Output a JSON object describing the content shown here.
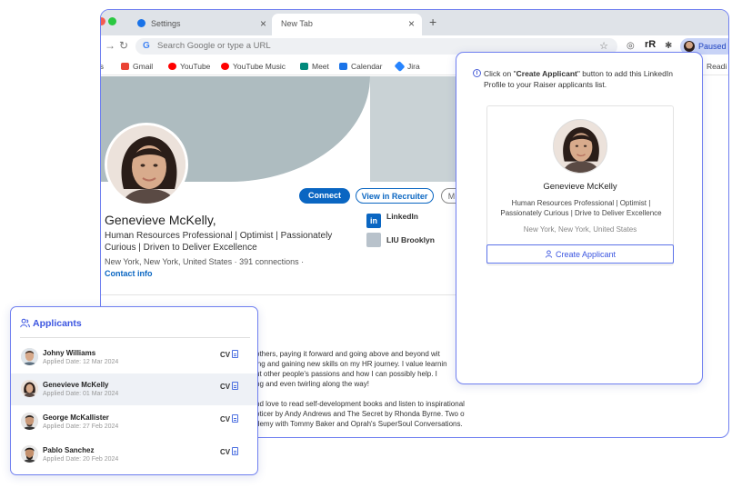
{
  "browser": {
    "tabs": [
      {
        "label": "Settings"
      },
      {
        "label": "New Tab"
      }
    ],
    "omnibox_placeholder": "Search Google or type a URL",
    "profile_status": "Paused",
    "extension_label": "rR",
    "bookmarks": [
      {
        "label": "ps",
        "color": "#ffffff"
      },
      {
        "label": "Gmail",
        "color": "#ea4335"
      },
      {
        "label": "YouTube",
        "color": "#ff0000"
      },
      {
        "label": "YouTube Music",
        "color": "#ff0000"
      },
      {
        "label": "Meet",
        "color": "#00897b"
      },
      {
        "label": "Calendar",
        "color": "#1a73e8"
      },
      {
        "label": "Jira",
        "color": "#2684ff"
      },
      {
        "label": "Readi",
        "color": "#ffffff"
      }
    ]
  },
  "linkedin": {
    "name": "Genevieve McKelly,",
    "headline": "Human Resources Professional | Optimist | Passionately Curious | Driven to Deliver Excellence",
    "location": "New York, New York, United States",
    "connections": "391 connections",
    "contact_info": "Contact info",
    "connect_label": "Connect",
    "recruiter_label": "View in Recruiter",
    "more_label": "M",
    "orgs": [
      {
        "label": "LinkedIn",
        "color": "#0a66c2"
      },
      {
        "label": "LIU Brooklyn",
        "color": "#8c9aa8"
      }
    ],
    "about_lines": [
      "others, paying it forward and going above and beyond wit",
      "ing and gaining new skills on my HR journey. I value learnin",
      "ut other people's passions and how I can possibly help. I",
      "ng and even twirling along the way!",
      "nd love to read self-development books and listen to inspirational",
      "oticer by Andy Andrews and The Secret by Rhonda Byrne. Two of",
      "demy with Tommy Baker and Oprah's SuperSoul Conversations."
    ]
  },
  "popup": {
    "info_prefix": "Click on \"",
    "info_bold": "Create Applicant",
    "info_suffix": "\" button to add this LinkedIn Profile to your Raiser applicants list.",
    "card": {
      "name": "Genevieve McKelly",
      "headline": "Human Resources Professional | Optimist | Passionately Curious | Drive to Deliver Excellence",
      "location": "New York, New York, United States"
    },
    "create_label": "Create Applicant"
  },
  "applicants": {
    "title": "Applicants",
    "items": [
      {
        "name": "Johny Williams",
        "date": "Applied Date: 12 Mar 2024",
        "cv": "CV",
        "selected": false
      },
      {
        "name": "Genevieve McKelly",
        "date": "Applied Date: 01 Mar 2024",
        "cv": "CV",
        "selected": true
      },
      {
        "name": "George McKallister",
        "date": "Applied Date: 27 Feb 2024",
        "cv": "CV",
        "selected": false
      },
      {
        "name": "Pablo Sanchez",
        "date": "Applied Date: 20 Feb 2024",
        "cv": "CV",
        "selected": false
      }
    ]
  },
  "colors": {
    "accent": "#3b55e0",
    "linkedin_blue": "#0a66c2",
    "frame": "#6f7ff0"
  }
}
